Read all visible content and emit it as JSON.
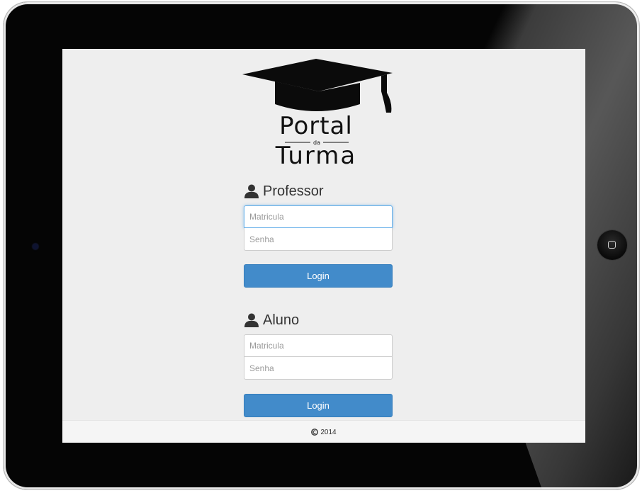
{
  "brand": {
    "logo_top": "Portal",
    "logo_mid": "da",
    "logo_bottom": "Turma"
  },
  "professor": {
    "title": "Professor",
    "matricula_placeholder": "Matricula",
    "senha_placeholder": "Senha",
    "login_label": "Login"
  },
  "aluno": {
    "title": "Aluno",
    "matricula_placeholder": "Matricula",
    "senha_placeholder": "Senha",
    "login_label": "Login"
  },
  "footer": {
    "year": "2014"
  },
  "colors": {
    "primary": "#428bca",
    "screen_bg": "#eeeeee",
    "frame": "#050505"
  }
}
